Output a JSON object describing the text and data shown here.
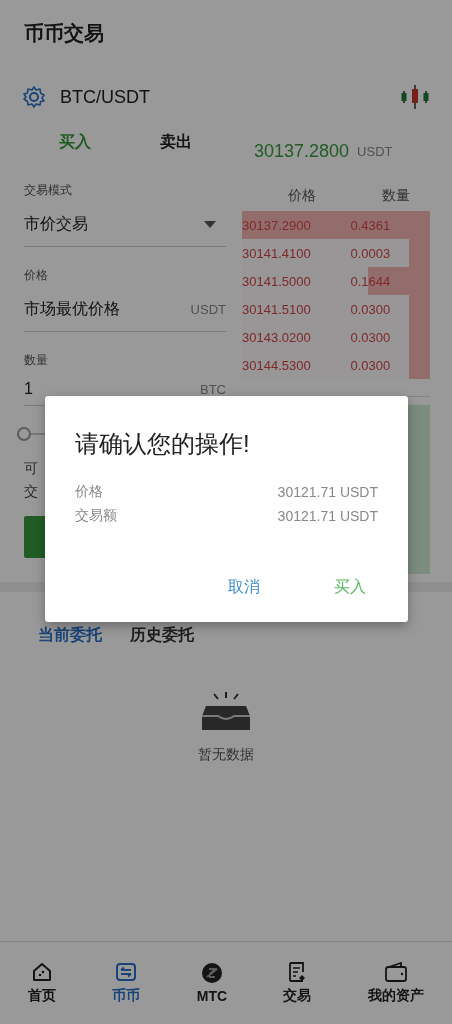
{
  "header": {
    "title": "币币交易"
  },
  "pair": {
    "symbol": "BTC/USDT"
  },
  "trade_tabs": [
    {
      "label": "买入",
      "selected": true
    },
    {
      "label": "卖出",
      "selected": false
    }
  ],
  "form": {
    "mode_label": "交易模式",
    "mode_value": "市价交易",
    "price_label": "价格",
    "price_value": "市场最优价格",
    "price_unit": "USDT",
    "amount_label": "数量",
    "amount_value": "1",
    "amount_unit": "BTC",
    "slider": {
      "level": 0
    },
    "available_label": "可",
    "volume_label": "交"
  },
  "order_book": {
    "last_price": "30137.2800",
    "last_price_unit": "USDT",
    "columns": [
      "价格",
      "数量"
    ],
    "asks": [
      {
        "price": "30137.2900",
        "amount": "0.4361",
        "level": 1
      },
      {
        "price": "30141.4100",
        "amount": "0.0003",
        "level": 0.11
      },
      {
        "price": "30141.5000",
        "amount": "0.1644",
        "level": 0.33
      },
      {
        "price": "30141.5100",
        "amount": "0.0300",
        "level": 0.11
      },
      {
        "price": "30143.0200",
        "amount": "0.0300",
        "level": 0.11
      },
      {
        "price": "30144.5300",
        "amount": "0.0300",
        "level": 0.11
      }
    ]
  },
  "order_tabs": [
    {
      "label": "当前委托",
      "selected": true
    },
    {
      "label": "历史委托",
      "selected": false
    }
  ],
  "empty_state": {
    "text": "暂无数据"
  },
  "bottom_nav": [
    {
      "label": "首页",
      "selected": false
    },
    {
      "label": "币币",
      "selected": true
    },
    {
      "label": "MTC",
      "selected": false
    },
    {
      "label": "交易",
      "selected": false
    },
    {
      "label": "我的资产",
      "selected": false
    }
  ],
  "dialog": {
    "title": "请确认您的操作!",
    "rows": [
      {
        "label": "价格",
        "value": "30121.71 USDT"
      },
      {
        "label": "交易额",
        "value": "30121.71 USDT"
      }
    ],
    "cancel": "取消",
    "confirm": "买入"
  }
}
